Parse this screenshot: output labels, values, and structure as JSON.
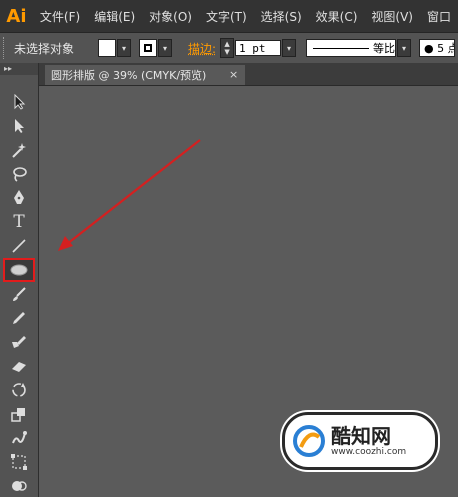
{
  "app": {
    "logo": "Ai"
  },
  "menu": [
    "文件(F)",
    "编辑(E)",
    "对象(O)",
    "文字(T)",
    "选择(S)",
    "效果(C)",
    "视图(V)",
    "窗口"
  ],
  "control_bar": {
    "selection_label": "未选择对象",
    "stroke_label": "描边:",
    "stroke_weight": "1 pt",
    "profile_label": "等比",
    "brush_label": "● 5 点"
  },
  "document_tab": {
    "title": "圆形排版 @ 39% (CMYK/预览)",
    "close": "×"
  },
  "toolbar": {
    "collapse": "▸▸",
    "tools": [
      {
        "name": "selection-tool",
        "icon": "selection-arrow-icon"
      },
      {
        "name": "direct-selection-tool",
        "icon": "direct-selection-icon"
      },
      {
        "name": "magic-wand-tool",
        "icon": "magic-wand-icon"
      },
      {
        "name": "lasso-tool",
        "icon": "lasso-icon"
      },
      {
        "name": "pen-tool",
        "icon": "pen-icon"
      },
      {
        "name": "type-tool",
        "icon": "type-icon",
        "glyph": "T"
      },
      {
        "name": "line-segment-tool",
        "icon": "line-icon"
      },
      {
        "name": "ellipse-tool",
        "icon": "ellipse-icon",
        "active": true
      },
      {
        "name": "paintbrush-tool",
        "icon": "brush-icon"
      },
      {
        "name": "pencil-tool",
        "icon": "pencil-icon"
      },
      {
        "name": "blob-brush-tool",
        "icon": "blob-brush-icon"
      },
      {
        "name": "eraser-tool",
        "icon": "eraser-icon"
      },
      {
        "name": "rotate-tool",
        "icon": "rotate-icon"
      },
      {
        "name": "scale-tool",
        "icon": "scale-icon"
      },
      {
        "name": "warp-tool",
        "icon": "warp-icon"
      },
      {
        "name": "free-transform-tool",
        "icon": "free-transform-icon"
      },
      {
        "name": "shape-builder-tool",
        "icon": "shape-builder-icon"
      }
    ]
  },
  "annotation": {
    "arrow_color": "#d42020"
  },
  "watermark": {
    "title": "酷知网",
    "url": "www.coozhi.com"
  },
  "colors": {
    "accent": "#ff9a00",
    "highlight": "#e21c1c"
  }
}
